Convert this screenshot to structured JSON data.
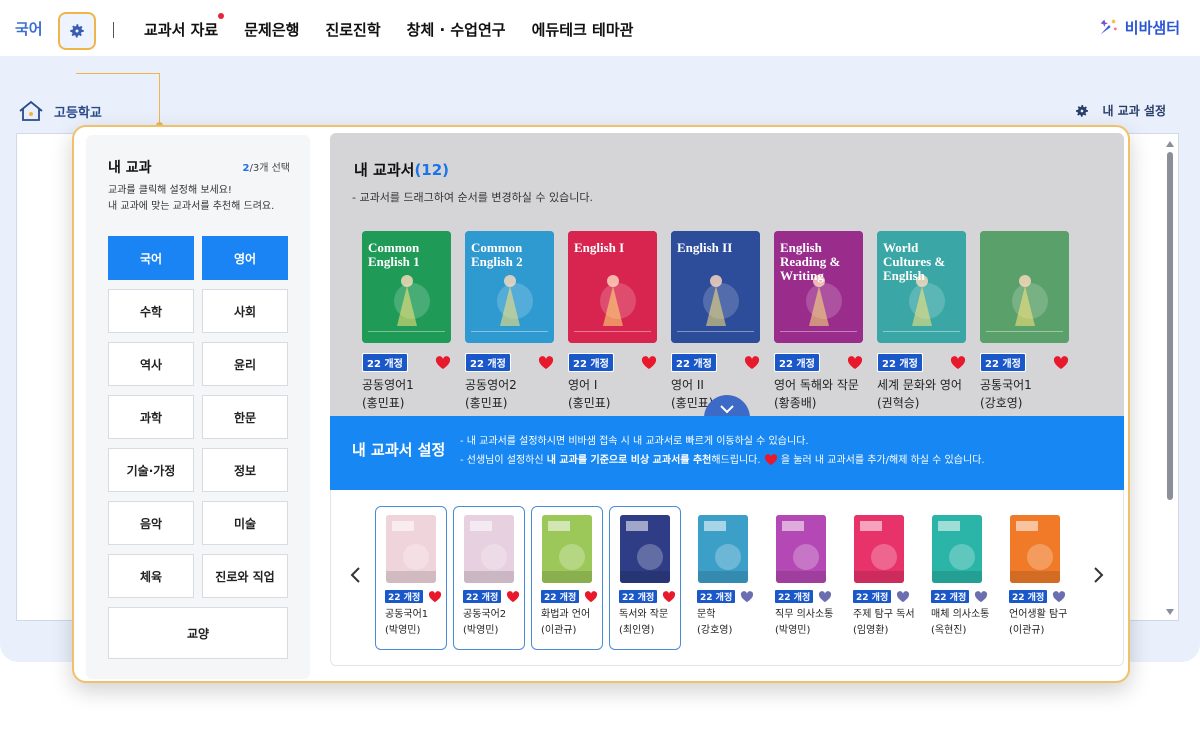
{
  "topbar": {
    "current_subject": "국어",
    "nav": [
      {
        "label": "교과서 자료",
        "dot": true
      },
      {
        "label": "문제은행",
        "dot": false
      },
      {
        "label": "진로진학",
        "dot": false
      },
      {
        "label": "창체 · 수업연구",
        "dot": false
      },
      {
        "label": "에듀테크 테마관",
        "dot": false
      }
    ],
    "brand": "비바샘터"
  },
  "breadcrumb": {
    "home_label": "고등학교",
    "my_subject_setting": "내 교과 설정"
  },
  "subject_panel": {
    "title": "내 교과",
    "count_selected": "2",
    "count_total": "/3개 선택",
    "desc_line1": "교과를 클릭해 설정해 보세요!",
    "desc_line2": "내 교과에 맞는 교과서를 추천해 드려요.",
    "subjects": [
      {
        "label": "국어",
        "selected": true
      },
      {
        "label": "영어",
        "selected": true
      },
      {
        "label": "수학",
        "selected": false
      },
      {
        "label": "사회",
        "selected": false
      },
      {
        "label": "역사",
        "selected": false
      },
      {
        "label": "윤리",
        "selected": false
      },
      {
        "label": "과학",
        "selected": false
      },
      {
        "label": "한문",
        "selected": false
      },
      {
        "label": "기술·가정",
        "selected": false
      },
      {
        "label": "정보",
        "selected": false
      },
      {
        "label": "음악",
        "selected": false
      },
      {
        "label": "미술",
        "selected": false
      },
      {
        "label": "체육",
        "selected": false
      },
      {
        "label": "진로와 직업",
        "selected": false
      },
      {
        "label": "교양",
        "selected": false,
        "wide": true
      }
    ]
  },
  "my_textbooks": {
    "title": "내 교과서",
    "count": "(12)",
    "desc": "- 교과서를 드래그하여 순서를 변경하실 수 있습니다.",
    "books": [
      {
        "badge": "22 개정",
        "name": "공동영어1",
        "author": "(홍민표)",
        "cover_text": "Common English 1",
        "bg": "#1f9a57"
      },
      {
        "badge": "22 개정",
        "name": "공동영어2",
        "author": "(홍민표)",
        "cover_text": "Common English 2",
        "bg": "#2f9ad0"
      },
      {
        "badge": "22 개정",
        "name": "영어 I",
        "author": "(홍민표)",
        "cover_text": "English I",
        "bg": "#d7254f"
      },
      {
        "badge": "22 개정",
        "name": "영어 II",
        "author": "(홍민표)",
        "cover_text": "English II",
        "bg": "#2d4c9a"
      },
      {
        "badge": "22 개정",
        "name": "영어 독해와 작문",
        "author": "(황종배)",
        "cover_text": "English Reading & Writing",
        "bg": "#9a2c8c"
      },
      {
        "badge": "22 개정",
        "name": "세계 문화와 영어",
        "author": "(권혁승)",
        "cover_text": "World Cultures & English",
        "bg": "#3aa7a6"
      },
      {
        "badge": "22 개정",
        "name": "공통국어1",
        "author": "(강호영)",
        "cover_text": "",
        "bg": "#5aa06a"
      }
    ]
  },
  "setting_banner": {
    "title": "내 교과서 설정",
    "line1": "- 내 교과서를 설정하시면 비바샘 접속 시 내 교과서로 빠르게 이동하실 수 있습니다.",
    "line2_pre": "- 선생님이 설정하신 ",
    "line2_bold": "내 교과를 기준으로 비상 교과서를 추천",
    "line2_mid": "해드립니다.",
    "line2_post": "을 눌러 내 교과서를 추가/해제 하실 수 있습니다."
  },
  "recommended": {
    "books": [
      {
        "badge": "22 개정",
        "name": "공동국어1",
        "author": "(박영민)",
        "selected": true,
        "liked": true,
        "bg": "#f0d4dc"
      },
      {
        "badge": "22 개정",
        "name": "공동국어2",
        "author": "(박영민)",
        "selected": true,
        "liked": true,
        "bg": "#e7d0e0"
      },
      {
        "badge": "22 개정",
        "name": "화법과 언어",
        "author": "(이관규)",
        "selected": true,
        "liked": true,
        "bg": "#9cc85a"
      },
      {
        "badge": "22 개정",
        "name": "독서와 작문",
        "author": "(최인영)",
        "selected": true,
        "liked": true,
        "bg": "#2e3d86"
      },
      {
        "badge": "22 개정",
        "name": "문학",
        "author": "(강호영)",
        "selected": false,
        "liked": false,
        "bg": "#3c9fc8"
      },
      {
        "badge": "22 개정",
        "name": "직무 의사소통",
        "author": "(박영민)",
        "selected": false,
        "liked": false,
        "bg": "#b448b4"
      },
      {
        "badge": "22 개정",
        "name": "주제 탐구 독서",
        "author": "(임영환)",
        "selected": false,
        "liked": false,
        "bg": "#e8336a"
      },
      {
        "badge": "22 개정",
        "name": "매체 의사소통",
        "author": "(옥현진)",
        "selected": false,
        "liked": false,
        "bg": "#2ab5a8"
      },
      {
        "badge": "22 개정",
        "name": "언어생활 탐구",
        "author": "(이관규)",
        "selected": false,
        "liked": false,
        "bg": "#f07a28"
      }
    ]
  },
  "colors": {
    "accent_blue": "#1a84f5",
    "heart_red": "#e8192c",
    "heart_inactive": "#6b6fb0",
    "highlight_orange": "#f0b54a"
  }
}
